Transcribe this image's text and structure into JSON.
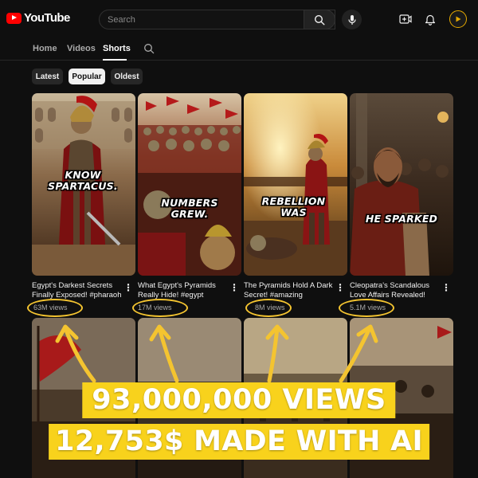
{
  "app": {
    "logo_text": "YouTube",
    "brand_color": "#ff0000"
  },
  "search": {
    "placeholder": "Search"
  },
  "header_icons": [
    "search-icon",
    "mic-icon",
    "create-icon",
    "bell-icon",
    "avatar"
  ],
  "tabs": [
    {
      "label": "Home",
      "active": false
    },
    {
      "label": "Videos",
      "active": false
    },
    {
      "label": "Shorts",
      "active": true
    }
  ],
  "chips": [
    {
      "label": "Latest",
      "active": false
    },
    {
      "label": "Popular",
      "active": true
    },
    {
      "label": "Oldest",
      "active": false
    }
  ],
  "shorts": [
    {
      "caption": "KNOW SPARTACUS.",
      "title": "Egypt's Darkest Secrets Finally Exposed! #pharaoh",
      "views": "63M views"
    },
    {
      "caption": "NUMBERS GREW.",
      "title": "What Egypt's Pyramids Really Hide! #egypt",
      "views": "17M views"
    },
    {
      "caption": "REBELLION WAS",
      "title": "The Pyramids Hold A Dark Secret! #amazing",
      "views": "8M views"
    },
    {
      "caption": "HE SPARKED",
      "title": "Cleopatra's Scandalous Love Affairs Revealed!",
      "views": "5.1M views"
    }
  ],
  "overlay": {
    "line1": "93,000,000 VIEWS",
    "line2": "12,753$ MADE WITH AI",
    "highlight_color": "#f8d21c",
    "annotation_color": "#f4c430"
  }
}
